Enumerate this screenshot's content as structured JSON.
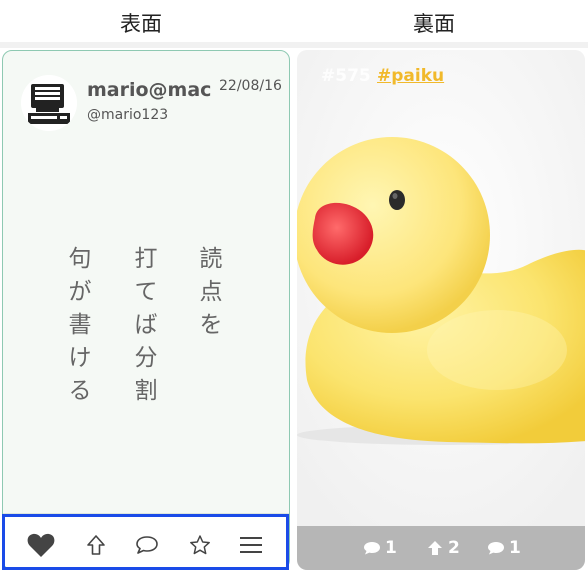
{
  "labels": {
    "front": "表面",
    "back": "裏面"
  },
  "post": {
    "username": "mario@mac",
    "handle": "@mario123",
    "date": "22/08/16",
    "poem_lines": [
      "読点を",
      "打てば分割",
      "句が書ける"
    ]
  },
  "actions": [
    {
      "name": "like",
      "icon": "heart-icon"
    },
    {
      "name": "share",
      "icon": "arrow-up-icon"
    },
    {
      "name": "comment",
      "icon": "speech-bubble-icon"
    },
    {
      "name": "favorite",
      "icon": "star-icon"
    },
    {
      "name": "menu",
      "icon": "hamburger-icon"
    }
  ],
  "back": {
    "number": "#575",
    "hashtag": "#paiku",
    "image": "rubber-duck-photo",
    "stats": [
      {
        "icon": "speech-bubble-icon",
        "value": "1"
      },
      {
        "icon": "arrow-up-icon",
        "value": "2"
      },
      {
        "icon": "speech-bubble-icon",
        "value": "1"
      }
    ]
  },
  "colors": {
    "card_border": "#8ec9b2",
    "card_bg": "#f5f9f5",
    "hashtag": "#f1b92b",
    "stats_bar": "#b6b6b6",
    "highlight_box": "#1a4be8"
  }
}
